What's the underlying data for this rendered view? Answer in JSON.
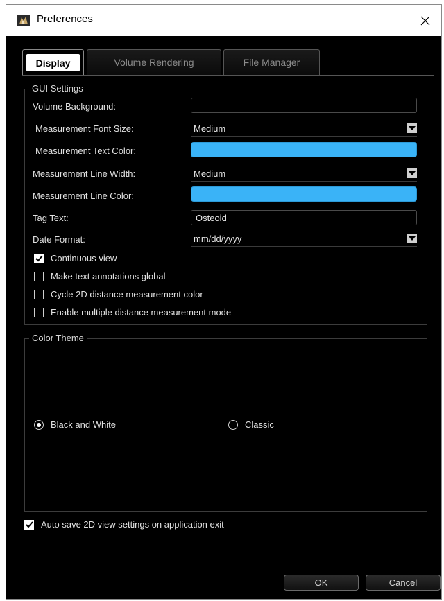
{
  "window": {
    "title": "Preferences",
    "icon": "app-logo-icon",
    "close_icon": "close-icon"
  },
  "tabs": [
    {
      "label": "Display",
      "active": true
    },
    {
      "label": "Volume Rendering",
      "active": false
    },
    {
      "label": "File Manager",
      "active": false
    }
  ],
  "gui_settings": {
    "title": "GUI Settings",
    "volume_background": {
      "label": "Volume Background:",
      "value": ""
    },
    "measurement_font_size": {
      "label": "Measurement Font Size:",
      "value": "Medium"
    },
    "measurement_text_color": {
      "label": "Measurement Text Color:",
      "color": "#3ab3f7"
    },
    "measurement_line_width": {
      "label": "Measurement Line Width:",
      "value": "Medium"
    },
    "measurement_line_color": {
      "label": "Measurement Line Color:",
      "color": "#3ab3f7"
    },
    "tag_text": {
      "label": "Tag Text:",
      "value": "Osteoid"
    },
    "date_format": {
      "label": "Date Format:",
      "value": "mm/dd/yyyy"
    },
    "checkboxes": [
      {
        "label": "Continuous view",
        "checked": true
      },
      {
        "label": "Make text annotations global",
        "checked": false
      },
      {
        "label": "Cycle 2D distance measurement color",
        "checked": false
      },
      {
        "label": "Enable multiple distance measurement mode",
        "checked": false
      }
    ]
  },
  "color_theme": {
    "title": "Color Theme",
    "options": [
      {
        "label": "Black and White",
        "selected": true
      },
      {
        "label": "Classic",
        "selected": false
      }
    ]
  },
  "auto_save": {
    "label": "Auto save 2D view settings on application exit",
    "checked": true
  },
  "buttons": {
    "ok": "OK",
    "cancel": "Cancel"
  },
  "colors": {
    "accent": "#3ab3f7",
    "background": "#000000"
  }
}
